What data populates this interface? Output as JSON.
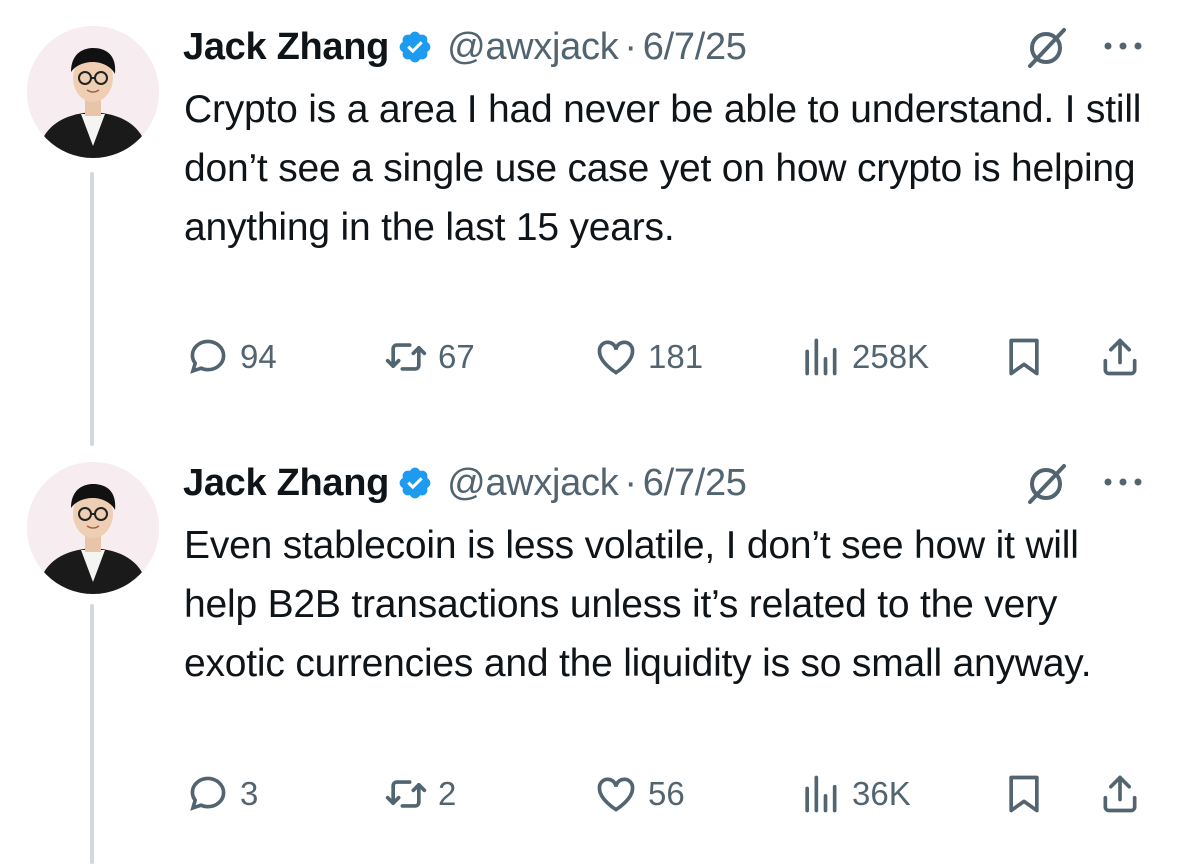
{
  "tweets": [
    {
      "author": {
        "name": "Jack Zhang",
        "handle": "@awxjack",
        "date": "6/7/25",
        "separator": "·"
      },
      "text": "Crypto is a area I had never be able to understand. I still don’t see a single use case yet on how crypto is helping anything in the last 15 years.",
      "stats": {
        "replies": "94",
        "reposts": "67",
        "likes": "181",
        "views": "258K"
      }
    },
    {
      "author": {
        "name": "Jack Zhang",
        "handle": "@awxjack",
        "date": "6/7/25",
        "separator": "·"
      },
      "text": "Even stablecoin is less volatile, I don’t see how it will help B2B transactions unless it’s related to the very exotic currencies and the liquidity is so small anyway.",
      "stats": {
        "replies": "3",
        "reposts": "2",
        "likes": "56",
        "views": "36K"
      }
    }
  ],
  "icons": {
    "verified": "verified-badge-icon",
    "grok": "grok-icon",
    "more": "more-options-icon",
    "reply": "reply-icon",
    "repost": "repost-icon",
    "like": "heart-icon",
    "views": "views-chart-icon",
    "bookmark": "bookmark-icon",
    "share": "share-icon"
  },
  "colors": {
    "text": "#0f1419",
    "secondary": "#536471",
    "verified": "#1d9bf0",
    "thread_line": "#cfd9de"
  }
}
